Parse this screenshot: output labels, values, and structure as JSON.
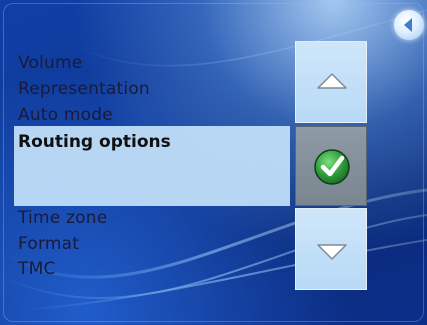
{
  "menu": {
    "items_above": [
      "Volume",
      "Representation",
      "Auto mode"
    ],
    "selected": "Routing options",
    "items_below": [
      "Time zone",
      "Format",
      "TMC"
    ]
  },
  "controls": {
    "back_icon": "back-arrow-icon",
    "up_icon": "up-triangle-icon",
    "confirm_icon": "check-icon",
    "down_icon": "down-triangle-icon"
  },
  "colors": {
    "background": "#0f3fa6",
    "selection": "#c3e1fa",
    "confirm_green": "#2e9a3a"
  }
}
